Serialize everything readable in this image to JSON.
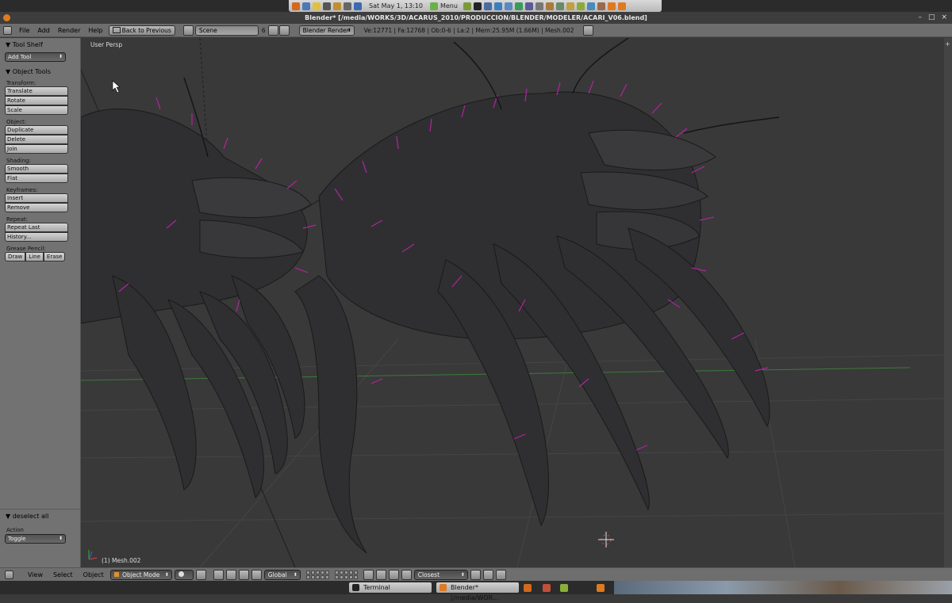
{
  "system_panel": {
    "clock": "Sat May  1, 13:10",
    "menu_label": "Menu"
  },
  "window": {
    "title": "Blender* [/media/WORKS/3D/ACARUS_2010/PRODUCCION/BLENDER/MODELER/ACARI_V06.blend]",
    "minimize": "–",
    "maximize": "□",
    "close": "×"
  },
  "info_header": {
    "menus": [
      "File",
      "Add",
      "Render",
      "Help"
    ],
    "back_button": "Back to Previous",
    "scene_name": "Scene",
    "scene_users": "6",
    "render_engine": "Blender Render",
    "stats": "Ve:12771 | Fa:12768 | Ob:0-6 | La:2 | Mem:25.95M (1.66M) | Mesh.002"
  },
  "tool_shelf": {
    "header": "Tool Shelf",
    "add_tool": "Add Tool",
    "object_tools": "Object Tools",
    "sections": [
      {
        "label": "Transform:",
        "buttons": [
          "Translate",
          "Rotate",
          "Scale"
        ]
      },
      {
        "label": "Object:",
        "buttons": [
          "Duplicate",
          "Delete",
          "Join"
        ]
      },
      {
        "label": "Shading:",
        "buttons": [
          "Smooth",
          "Flat"
        ]
      },
      {
        "label": "Keyframes:",
        "buttons": [
          "Insert",
          "Remove"
        ]
      },
      {
        "label": "Repeat:",
        "buttons": [
          "Repeat Last",
          "History..."
        ]
      }
    ],
    "grease_pencil_label": "Grease Pencil:",
    "grease_pencil_buttons": [
      "Draw",
      "Line",
      "Erase"
    ],
    "operator_panel": "deselect all",
    "action_label": "Action",
    "action_value": "Toggle"
  },
  "viewport": {
    "view_label": "User Persp",
    "object_label": "(1) Mesh.002"
  },
  "view_header": {
    "menus": [
      "View",
      "Select",
      "Object"
    ],
    "mode": "Object Mode",
    "orientation": "Global",
    "snap_target": "Closest"
  },
  "taskbar": {
    "tasks": [
      "Terminal",
      "Blender* [/media/WOR..."
    ]
  },
  "colors": {
    "hair_magenta": "#b0249e",
    "mesh_dark": "#2f2f31",
    "grid_green": "#3c7a3c"
  }
}
